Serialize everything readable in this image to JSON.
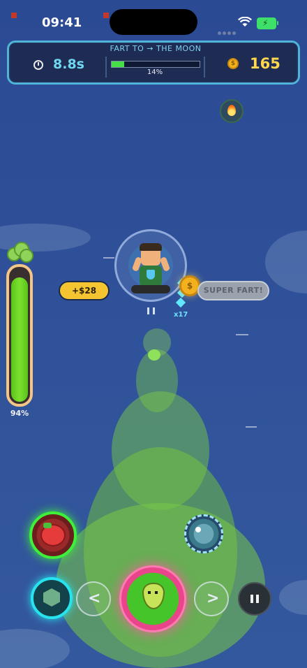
{
  "status_bar": {
    "time": "09:41"
  },
  "hud": {
    "title": "FART TO → THE MOON",
    "timer": "8.8s",
    "progress_fraction": 0.14,
    "progress_label": "14%",
    "coins": "165",
    "coin_symbol": "$"
  },
  "meter": {
    "fill_fraction": 0.94,
    "label": "94%"
  },
  "popups": {
    "money": "+$28",
    "combo": "x17",
    "super_fart": "SUPER FART!",
    "coin_symbol": "$"
  },
  "controls": {
    "left_chevron": "<",
    "right_chevron": ">"
  },
  "colors": {
    "accent_progress": "#46e046",
    "coins": "#ffd84d",
    "timer": "#6fd8f0",
    "fart_button_ring": "#ff5aa0",
    "shield_button_ring": "#27e3ee",
    "tomato_ring": "#3ef03a"
  },
  "icons": [
    "timer-icon",
    "coin-icon",
    "fire-pickup-icon",
    "shield-icon",
    "tomato-icon",
    "monster-icon",
    "pear-icon",
    "pause-icon",
    "chevron-left-icon",
    "chevron-right-icon"
  ]
}
